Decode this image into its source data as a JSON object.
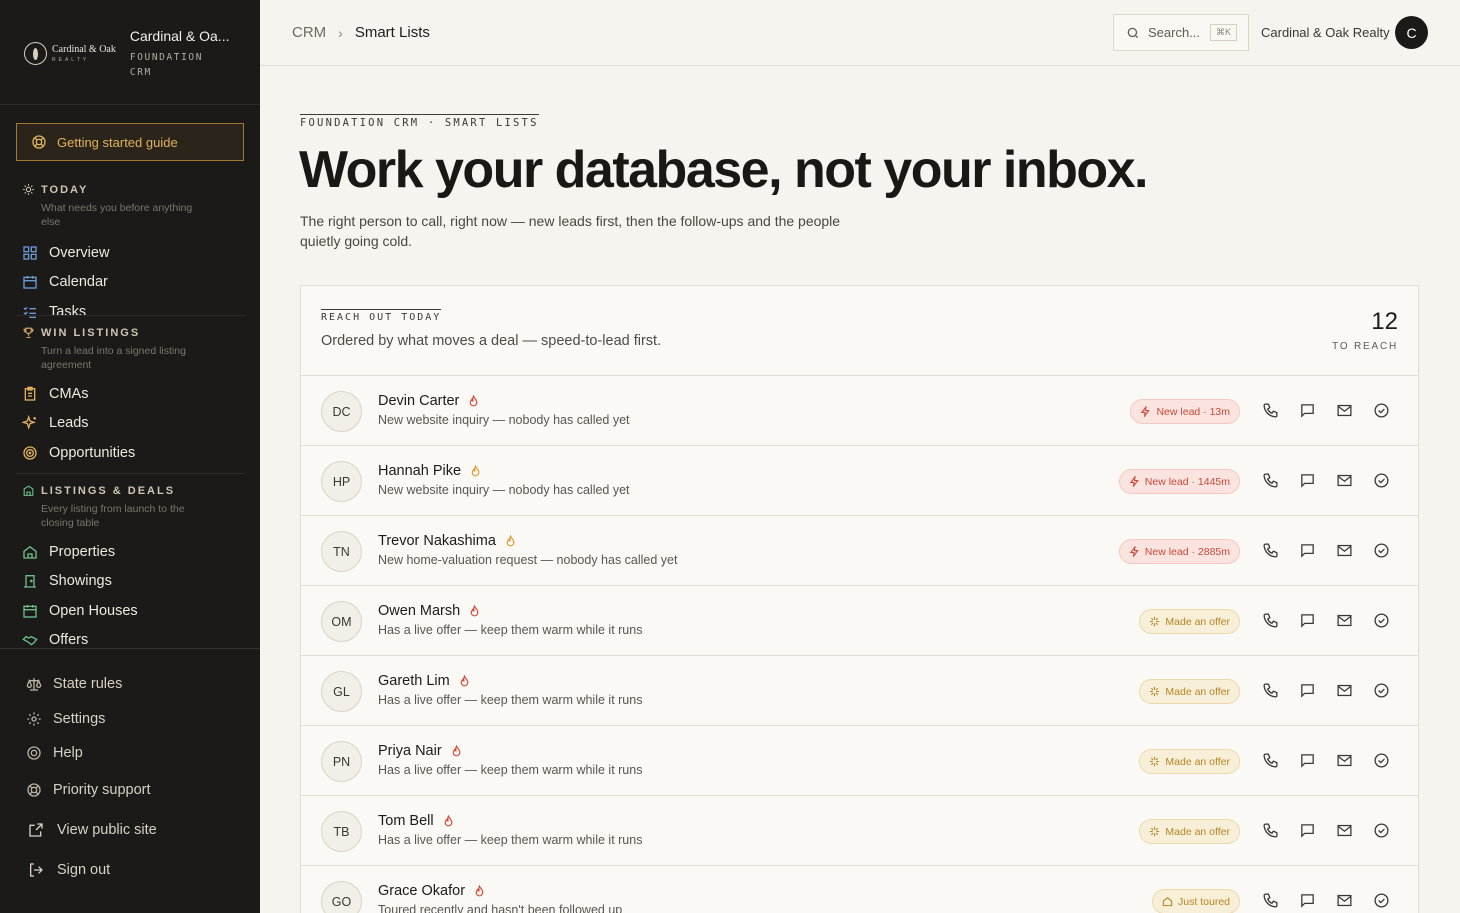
{
  "brand": {
    "title": "Cardinal & Oa...",
    "subtitle": "FOUNDATION CRM",
    "logo_text": "Cardinal & Oak",
    "logo_sub": "REALTY"
  },
  "sidebar": {
    "guide_label": "Getting started guide",
    "sections": [
      {
        "title": "TODAY",
        "desc": "What needs you before anything else",
        "items": [
          "Overview",
          "Calendar",
          "Tasks"
        ]
      },
      {
        "title": "WIN LISTINGS",
        "desc": "Turn a lead into a signed listing agreement",
        "items": [
          "CMAs",
          "Leads",
          "Opportunities"
        ]
      },
      {
        "title": "LISTINGS & DEALS",
        "desc": "Every listing from launch to the closing table",
        "items": [
          "Properties",
          "Showings",
          "Open Houses",
          "Offers"
        ]
      }
    ],
    "footer": [
      "State rules",
      "Settings",
      "Help",
      "Priority support",
      "View public site",
      "Sign out"
    ]
  },
  "topbar": {
    "breadcrumb_root": "CRM",
    "breadcrumb_current": "Smart Lists",
    "search_placeholder": "Search...",
    "search_kbd": "⌘K",
    "org_name": "Cardinal & Oak Realty",
    "avatar_initial": "C"
  },
  "page": {
    "eyebrow": "FOUNDATION CRM · SMART LISTS",
    "title": "Work your database, not your inbox.",
    "subtitle": "The right person to call, right now — new leads first, then the follow-ups and the people quietly going cold."
  },
  "card": {
    "eyebrow": "REACH OUT TODAY",
    "desc": "Ordered by what moves a deal — speed-to-lead first.",
    "count": "12",
    "count_label": "TO REACH"
  },
  "contacts": [
    {
      "initials": "DC",
      "name": "Devin Carter",
      "desc": "New website inquiry — nobody has called yet",
      "badge": "New lead · 13m",
      "badge_type": "red",
      "flame": "#d9493a"
    },
    {
      "initials": "HP",
      "name": "Hannah Pike",
      "desc": "New website inquiry — nobody has called yet",
      "badge": "New lead · 1445m",
      "badge_type": "red",
      "flame": "#e09a2e"
    },
    {
      "initials": "TN",
      "name": "Trevor Nakashima",
      "desc": "New home-valuation request — nobody has called yet",
      "badge": "New lead · 2885m",
      "badge_type": "red",
      "flame": "#e09a2e"
    },
    {
      "initials": "OM",
      "name": "Owen Marsh",
      "desc": "Has a live offer — keep them warm while it runs",
      "badge": "Made an offer",
      "badge_type": "amber",
      "flame": "#d9493a"
    },
    {
      "initials": "GL",
      "name": "Gareth Lim",
      "desc": "Has a live offer — keep them warm while it runs",
      "badge": "Made an offer",
      "badge_type": "amber",
      "flame": "#d9493a"
    },
    {
      "initials": "PN",
      "name": "Priya Nair",
      "desc": "Has a live offer — keep them warm while it runs",
      "badge": "Made an offer",
      "badge_type": "amber",
      "flame": "#d9493a"
    },
    {
      "initials": "TB",
      "name": "Tom Bell",
      "desc": "Has a live offer — keep them warm while it runs",
      "badge": "Made an offer",
      "badge_type": "amber",
      "flame": "#d9493a"
    },
    {
      "initials": "GO",
      "name": "Grace Okafor",
      "desc": "Toured recently and hasn't been followed up",
      "badge": "Just toured",
      "badge_type": "amber",
      "flame": "#d9493a"
    }
  ]
}
